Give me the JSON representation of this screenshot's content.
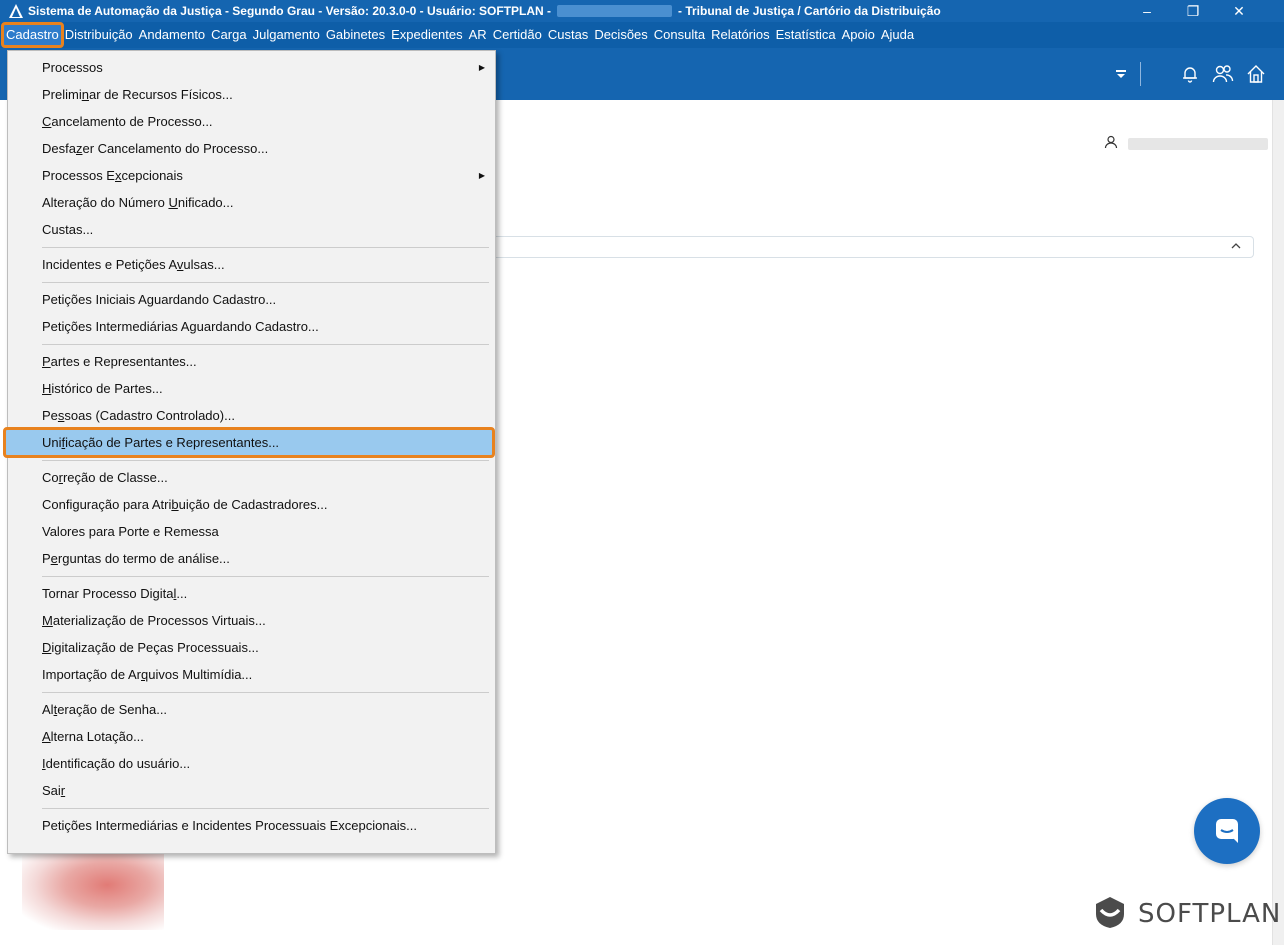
{
  "window": {
    "title_left": "Sistema de Automação da Justiça - Segundo Grau - Versão: 20.3.0-0 - Usuário: SOFTPLAN -",
    "title_right": "- Tribunal de Justiça / Cartório da Distribuição",
    "minimize": "–",
    "maximize": "❐",
    "close": "✕"
  },
  "menubar": {
    "items": [
      "Cadastro",
      "Distribuição",
      "Andamento",
      "Carga",
      "Julgamento",
      "Gabinetes",
      "Expedientes",
      "AR",
      "Certidão",
      "Custas",
      "Decisões",
      "Consulta",
      "Relatórios",
      "Estatística",
      "Apoio",
      "Ajuda"
    ]
  },
  "toolbar": {
    "icons": [
      "filter-icon",
      "bell-icon",
      "users-icon",
      "home-icon"
    ]
  },
  "dropdown": {
    "items": [
      {
        "pre": "Processos",
        "u": "",
        "post": "",
        "submenu": true
      },
      {
        "pre": "Prelimi",
        "u": "n",
        "post": "ar de Recursos Físicos...",
        "submenu": false
      },
      {
        "pre": "",
        "u": "C",
        "post": "ancelamento de Processo...",
        "submenu": false
      },
      {
        "pre": "Desfa",
        "u": "z",
        "post": "er Cancelamento do Processo...",
        "submenu": false
      },
      {
        "pre": "Processos E",
        "u": "x",
        "post": "cepcionais",
        "submenu": true
      },
      {
        "pre": "Alteração do Número ",
        "u": "U",
        "post": "nificado...",
        "submenu": false
      },
      {
        "pre": "Custas...",
        "u": "",
        "post": "",
        "submenu": false
      },
      {
        "separator": true
      },
      {
        "pre": "Incidentes e Petições A",
        "u": "v",
        "post": "ulsas...",
        "submenu": false
      },
      {
        "separator": true
      },
      {
        "pre": "Petições Iniciais A",
        "u": "g",
        "post": "uardando Cadastro...",
        "submenu": false
      },
      {
        "pre": "Petições Intermediárias Aguardando Cadastro...",
        "u": "",
        "post": "",
        "submenu": false
      },
      {
        "separator": true
      },
      {
        "pre": "",
        "u": "P",
        "post": "artes e Representantes...",
        "submenu": false
      },
      {
        "pre": "",
        "u": "H",
        "post": "istórico de Partes...",
        "submenu": false
      },
      {
        "pre": "Pe",
        "u": "s",
        "post": "soas (Cadastro Controlado)...",
        "submenu": false
      },
      {
        "pre": "Uni",
        "u": "f",
        "post": "icação de Partes e Representantes...",
        "submenu": false,
        "highlight": true
      },
      {
        "separator": true
      },
      {
        "pre": "Co",
        "u": "r",
        "post": "reção de Classe...",
        "submenu": false
      },
      {
        "pre": "Configuração para Atri",
        "u": "b",
        "post": "uição de Cadastradores...",
        "submenu": false
      },
      {
        "pre": "Valores para Porte e Remessa",
        "u": "",
        "post": "",
        "submenu": false
      },
      {
        "pre": "P",
        "u": "e",
        "post": "rguntas do termo de análise...",
        "submenu": false
      },
      {
        "separator": true
      },
      {
        "pre": "Tornar Processo Digita",
        "u": "l",
        "post": "...",
        "submenu": false
      },
      {
        "pre": "",
        "u": "M",
        "post": "aterialização de Processos Virtuais...",
        "submenu": false
      },
      {
        "pre": "",
        "u": "D",
        "post": "igitalização de Peças Processuais...",
        "submenu": false
      },
      {
        "pre": "Importação de Ar",
        "u": "q",
        "post": "uivos Multimídia...",
        "submenu": false
      },
      {
        "separator": true
      },
      {
        "pre": "Al",
        "u": "t",
        "post": "eração de Senha...",
        "submenu": false
      },
      {
        "pre": "",
        "u": "A",
        "post": "lterna Lotação...",
        "submenu": false
      },
      {
        "pre": "",
        "u": "I",
        "post": "dentificação do usuário...",
        "submenu": false
      },
      {
        "pre": "Sai",
        "u": "r",
        "post": "",
        "submenu": false
      },
      {
        "separator": true
      },
      {
        "pre": "Petições Intermediárias e Incidentes Processuais Excepcionais...",
        "u": "",
        "post": "",
        "submenu": false
      }
    ]
  },
  "brand": {
    "logo_text": "SOFTPLAN",
    "accent": "#e8821e",
    "primary": "#1565b0"
  }
}
